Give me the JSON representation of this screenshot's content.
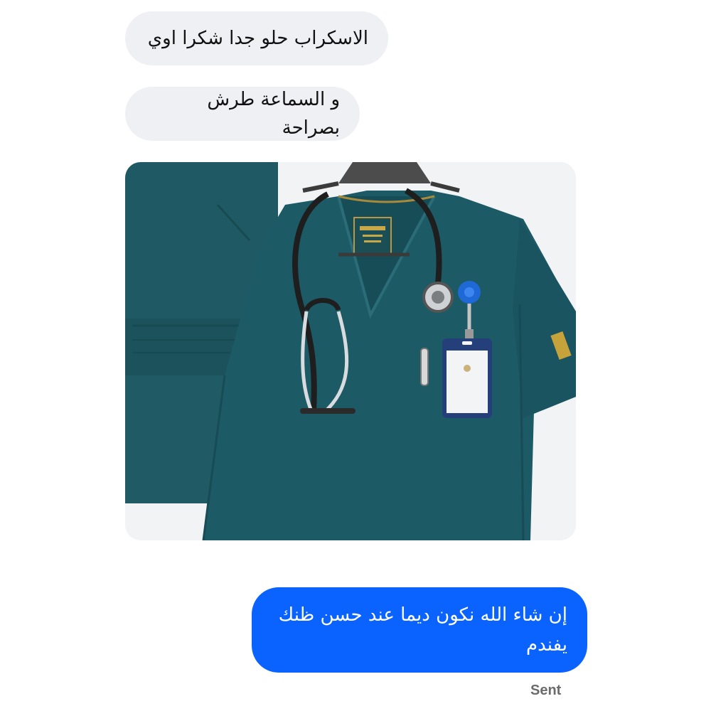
{
  "messages": [
    {
      "direction": "incoming",
      "text": "الاسكراب حلو جدا شكرا اوي"
    },
    {
      "direction": "incoming",
      "text": "و السماعة طرش بصراحة"
    },
    {
      "direction": "outgoing",
      "text": "إن شاء الله نكون ديما عند حسن ظنك يفندم"
    }
  ],
  "status_label": "Sent",
  "colors": {
    "incoming_bubble": "#eef0f3",
    "outgoing_bubble": "#0a62ff",
    "scrub": "#1a5a66"
  }
}
